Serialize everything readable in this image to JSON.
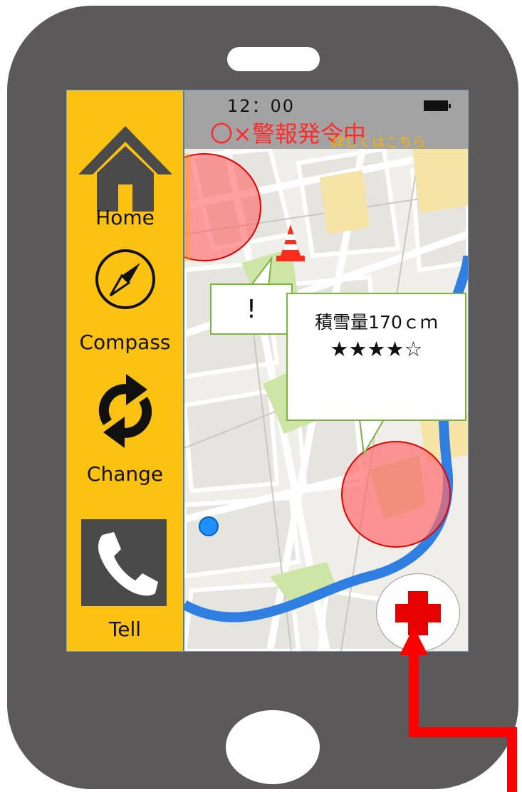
{
  "status_bar": {
    "time": "12：00",
    "alert": "〇×警報発令中",
    "details_link": "詳しくはこちら"
  },
  "sidebar": {
    "items": [
      {
        "label": "Home",
        "icon": "home-icon"
      },
      {
        "label": "Compass",
        "icon": "compass-icon"
      },
      {
        "label": "Change",
        "icon": "refresh-icon"
      },
      {
        "label": "Tell",
        "icon": "phone-icon"
      }
    ]
  },
  "map": {
    "warning_callout": "!",
    "info_callout": {
      "snow_depth": "積雪量170ｃｍ",
      "rating_stars": "★★★★☆",
      "rating": 4,
      "rating_max": 5
    }
  },
  "colors": {
    "sidebar": "#fcc211",
    "phone_body": "#5b5959",
    "alert": "#ff2a2a",
    "hazard_zone": "#ff6b6b",
    "emergency_cross": "#e60000",
    "callout_border": "#7cb342",
    "arrow": "#ff0000"
  }
}
